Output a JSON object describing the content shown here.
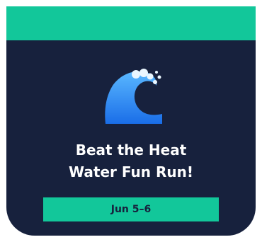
{
  "card": {
    "title_line1": "Beat the Heat",
    "title_line2": "Water Fun Run!",
    "date": "Jun 5–6",
    "icon": "water-wave-icon"
  },
  "colors": {
    "background": "#17213d",
    "accent": "#12c79a",
    "text": "#ffffff",
    "wave_light": "#5ab8ff",
    "wave_dark": "#1a6ee8"
  }
}
